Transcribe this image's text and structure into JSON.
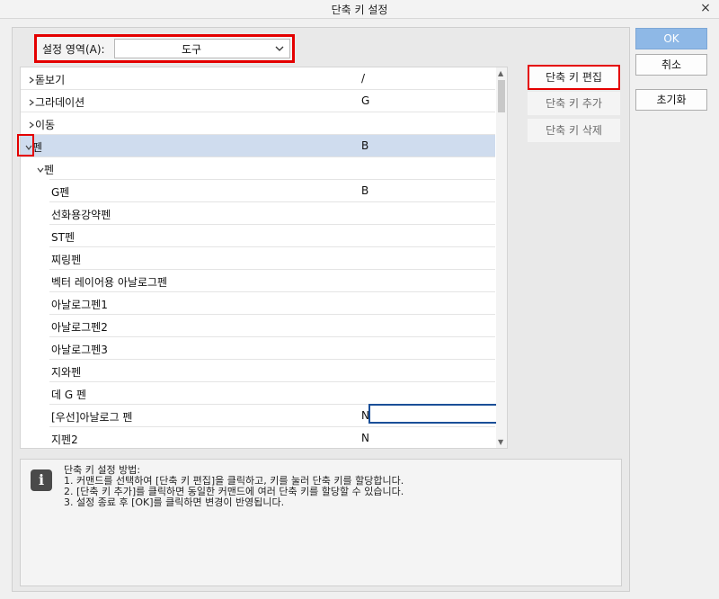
{
  "window": {
    "title": "단축 키 설정",
    "close_glyph": "×"
  },
  "area": {
    "label": "설정 영역(A):",
    "value": "도구"
  },
  "list": {
    "rows": [
      {
        "name": "돋보기",
        "key": "/"
      },
      {
        "name": "그라데이션",
        "key": "G"
      },
      {
        "name": "이동",
        "key": ""
      },
      {
        "name": "펜",
        "key": "B"
      },
      {
        "name": "펜",
        "key": ""
      },
      {
        "name": "G펜",
        "key": "B"
      },
      {
        "name": "선화용강약펜",
        "key": ""
      },
      {
        "name": "ST펜",
        "key": ""
      },
      {
        "name": "찌링펜",
        "key": ""
      },
      {
        "name": "벡터 레이어용 아날로그펜",
        "key": ""
      },
      {
        "name": "아날로그펜1",
        "key": ""
      },
      {
        "name": "아날로그펜2",
        "key": ""
      },
      {
        "name": "아날로그펜3",
        "key": ""
      },
      {
        "name": "지와펜",
        "key": ""
      },
      {
        "name": "데 G 펜",
        "key": ""
      },
      {
        "name": "[우선]아날로그 펜",
        "key": "N"
      },
      {
        "name": "지펜2",
        "key": "N"
      }
    ]
  },
  "side_buttons": {
    "edit": "단축 키 편집",
    "add": "단축 키 추가",
    "delete": "단축 키 삭제"
  },
  "dialog_buttons": {
    "ok": "OK",
    "cancel": "취소",
    "reset": "초기화"
  },
  "help": {
    "title": "단축 키 설정 방법:",
    "line1": "1. 커맨드를 선택하여 [단축 키 편집]을 클릭하고, 키를 눌러 단축 키를 할당합니다.",
    "line2": "2. [단축 키 추가]를 클릭하면 동일한 커맨드에 여러 단축 키를 할당할 수 있습니다.",
    "line3": "3. 설정 종료 후 [OK]를 클릭하면 변경이 반영됩니다."
  }
}
